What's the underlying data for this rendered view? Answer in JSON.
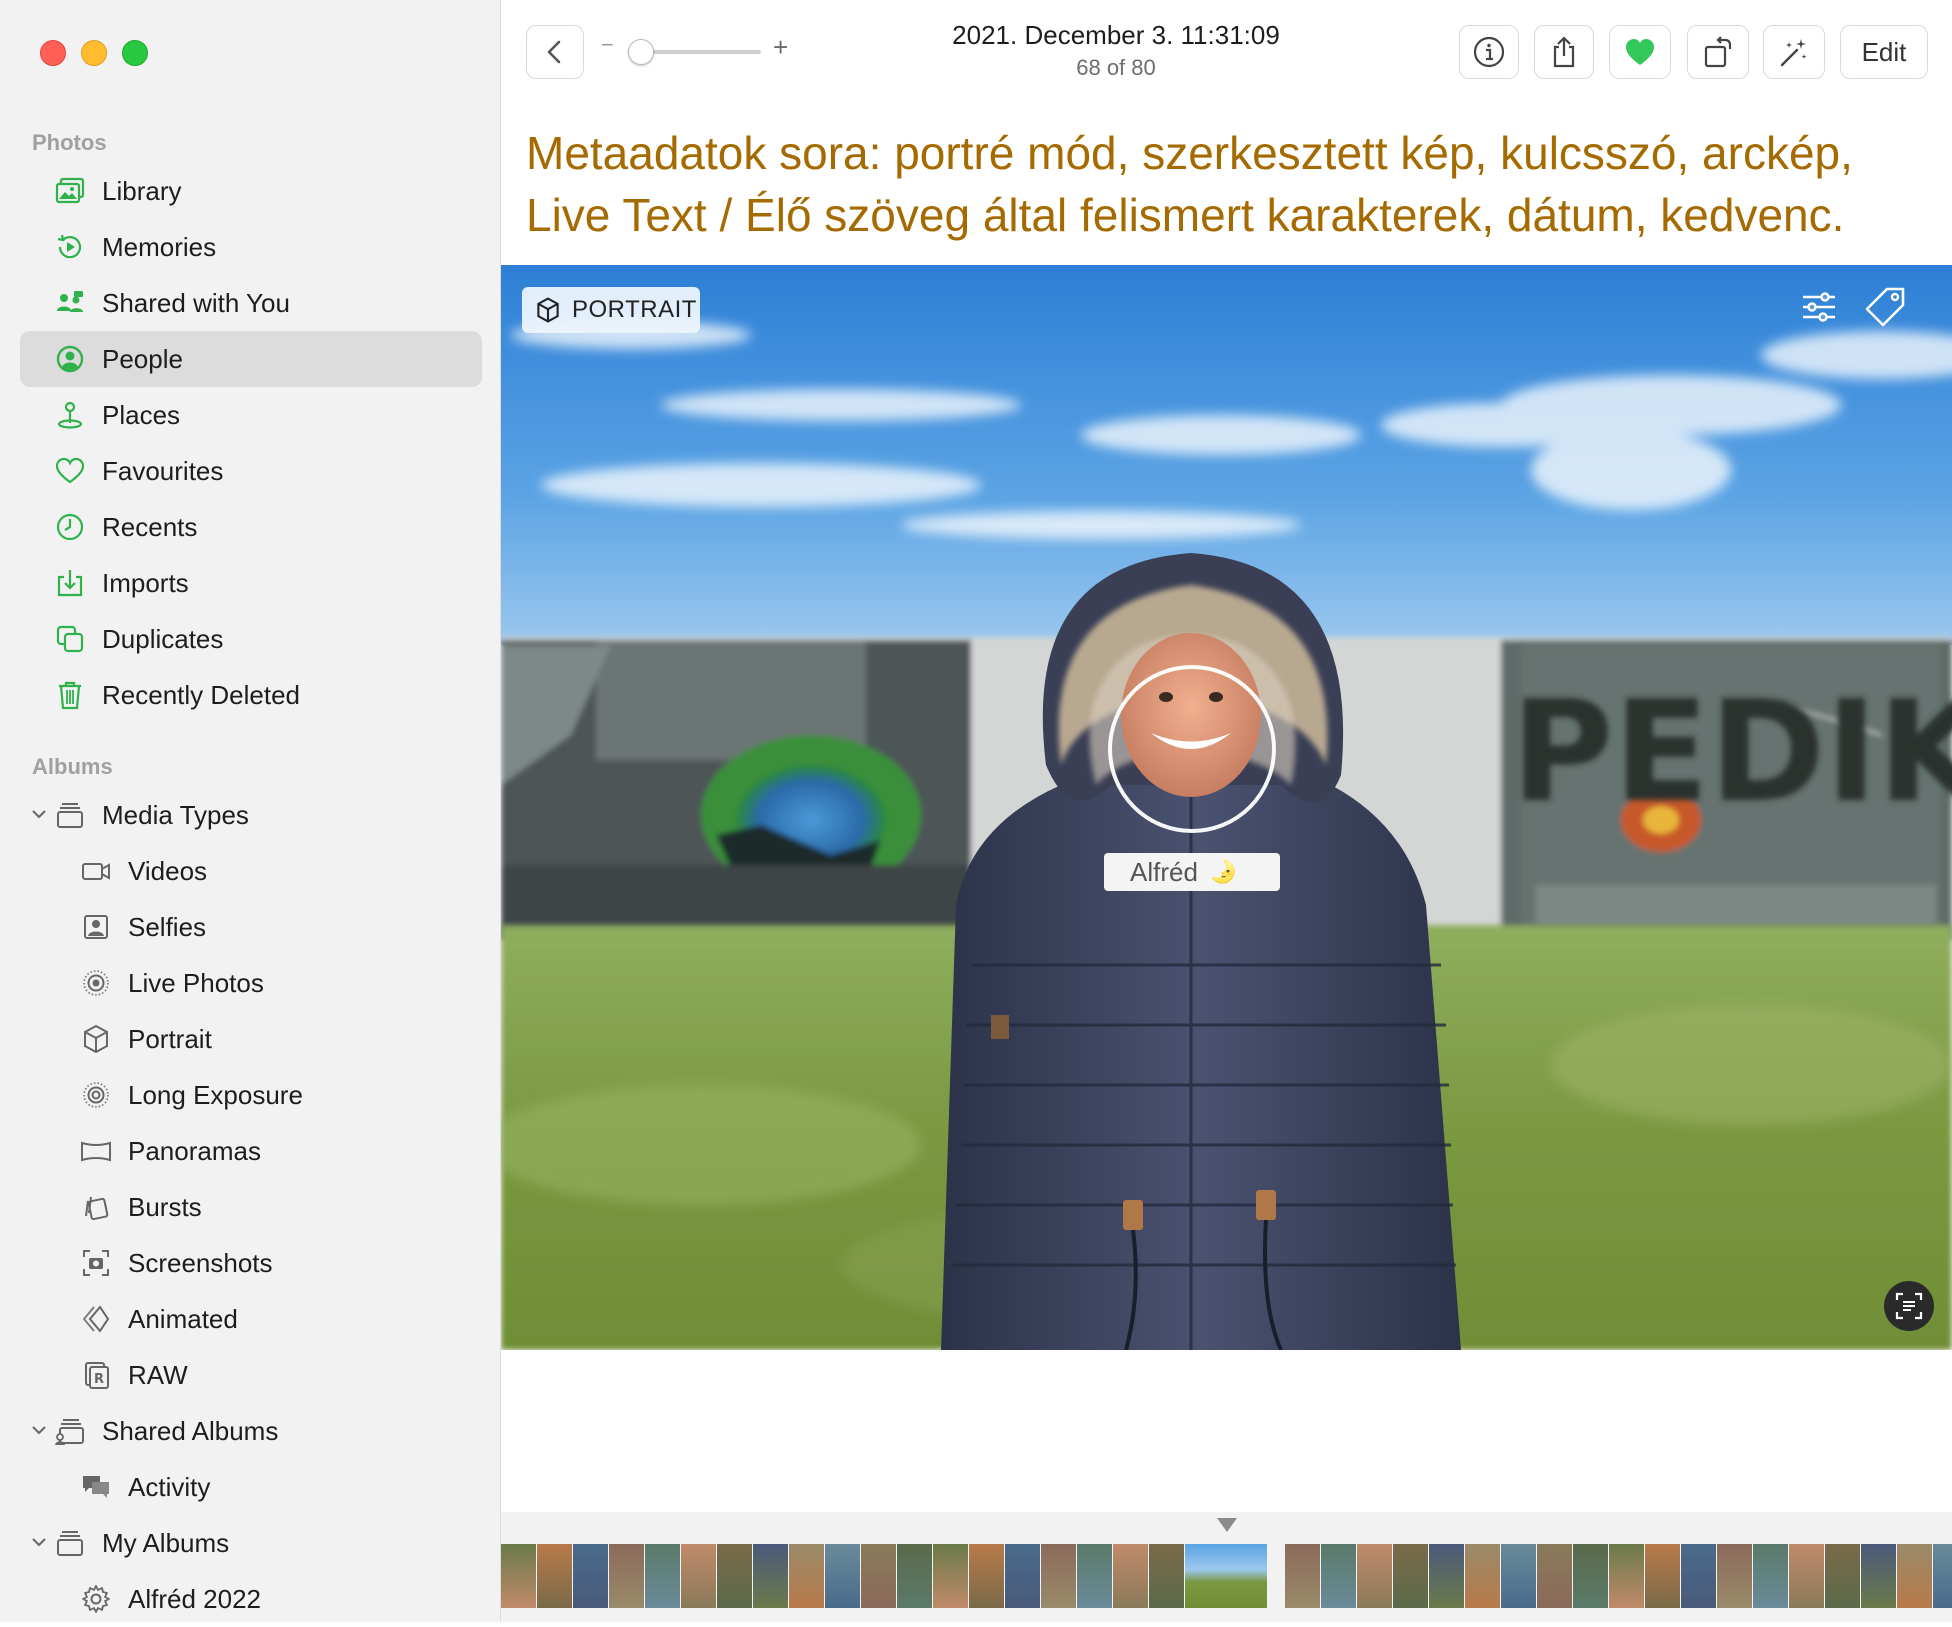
{
  "window": {
    "traffic_lights": [
      "close",
      "minimize",
      "zoom"
    ]
  },
  "sidebar": {
    "section_photos": "Photos",
    "section_albums": "Albums",
    "photos_items": [
      {
        "label": "Library",
        "icon": "library-icon"
      },
      {
        "label": "Memories",
        "icon": "memories-icon"
      },
      {
        "label": "Shared with You",
        "icon": "shared-with-you-icon"
      },
      {
        "label": "People",
        "icon": "people-icon",
        "selected": true
      },
      {
        "label": "Places",
        "icon": "places-icon"
      },
      {
        "label": "Favourites",
        "icon": "heart-icon"
      },
      {
        "label": "Recents",
        "icon": "clock-icon"
      },
      {
        "label": "Imports",
        "icon": "import-icon"
      },
      {
        "label": "Duplicates",
        "icon": "duplicates-icon"
      },
      {
        "label": "Recently Deleted",
        "icon": "trash-icon"
      }
    ],
    "media_types": {
      "label": "Media Types",
      "items": [
        {
          "label": "Videos",
          "icon": "video-icon"
        },
        {
          "label": "Selfies",
          "icon": "selfie-icon"
        },
        {
          "label": "Live Photos",
          "icon": "live-photo-icon"
        },
        {
          "label": "Portrait",
          "icon": "cube-icon"
        },
        {
          "label": "Long Exposure",
          "icon": "long-exposure-icon"
        },
        {
          "label": "Panoramas",
          "icon": "panorama-icon"
        },
        {
          "label": "Bursts",
          "icon": "burst-icon"
        },
        {
          "label": "Screenshots",
          "icon": "screenshot-icon"
        },
        {
          "label": "Animated",
          "icon": "animated-icon"
        },
        {
          "label": "RAW",
          "icon": "raw-icon"
        }
      ]
    },
    "shared_albums": {
      "label": "Shared Albums",
      "items": [
        {
          "label": "Activity",
          "icon": "activity-icon"
        }
      ]
    },
    "my_albums": {
      "label": "My Albums",
      "items": [
        {
          "label": "Alfréd 2022",
          "icon": "gear-icon"
        }
      ]
    }
  },
  "toolbar": {
    "date": "2021. December 3. 11:31:09",
    "count": "68 of 80",
    "zoom_minus": "−",
    "zoom_plus": "+",
    "zoom_level": 0.0,
    "edit_label": "Edit",
    "favourite_color": "#34c759"
  },
  "caption": {
    "text": "Metaadatok sora: portré mód, szerkesztett kép, kulcsszó, arckép, Live Text / Élő szöveg által felismert karakterek, dátum, kedvenc."
  },
  "photo": {
    "badge": "PORTRAIT",
    "face_name": "Alfréd",
    "face_emoji": "🌛",
    "wall_text": "PEDIK"
  },
  "filmstrip": {
    "current_index": 68,
    "total": 80
  },
  "colors": {
    "accent": "#34c759",
    "caption": "#a56a00",
    "selected_row": "#dcdcdc"
  }
}
